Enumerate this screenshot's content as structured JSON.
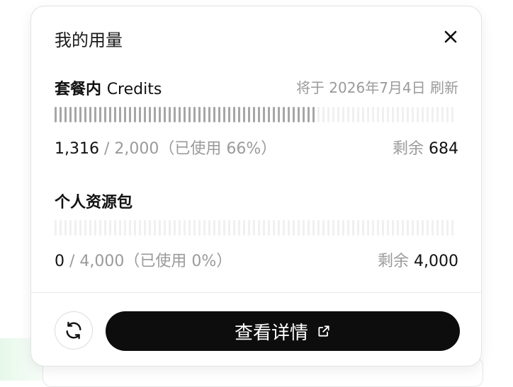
{
  "panel": {
    "title": "我的用量",
    "close_icon": "close-icon"
  },
  "plan": {
    "title_cn": "套餐内",
    "title_latin": "Credits",
    "renew_text": "将于 2026年7月4日 刷新",
    "used": "1,316",
    "total_text": " / 2,000（已使用 66%）",
    "remaining_label": "剩余",
    "remaining_value": "684",
    "used_fraction": 0.66
  },
  "pack": {
    "title": "个人资源包",
    "used": "0",
    "total_text": " / 4,000（已使用 0%）",
    "remaining_label": "剩余",
    "remaining_value": "4,000",
    "used_fraction": 0
  },
  "footer": {
    "refresh_icon": "refresh-icon",
    "details_label": "查看详情",
    "external_icon": "external-link-icon"
  },
  "colors": {
    "bar_on": "#a6a6a6",
    "bar_off": "#f0f0f0",
    "button_bg": "#0d0d0d"
  }
}
